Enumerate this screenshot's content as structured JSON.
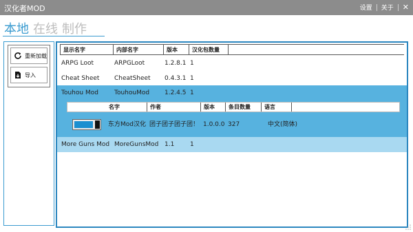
{
  "window": {
    "title": "汉化者MOD",
    "settings": "设置",
    "about": "关于",
    "close": "✕"
  },
  "tabs": [
    "本地",
    "在线",
    "制作"
  ],
  "sidebar": {
    "reload_label": "重新加载",
    "import_label": "导入"
  },
  "grid": {
    "headers": [
      "显示名字",
      "内部名字",
      "版本",
      "汉化包数量"
    ],
    "rows": [
      {
        "display": "ARPG Loot",
        "internal": "ARPGLoot",
        "version": "1.2.8.1",
        "count": "1"
      },
      {
        "display": "Cheat Sheet",
        "internal": "CheatSheet",
        "version": "0.4.3.1",
        "count": "1"
      },
      {
        "display": "Touhou Mod",
        "internal": "TouhouMod",
        "version": "1.2.4.5",
        "count": "1"
      },
      {
        "display": "More Guns Mod",
        "internal": "MoreGunsMod",
        "version": "1.1",
        "count": "1"
      }
    ]
  },
  "subgrid": {
    "headers": [
      "名字",
      "作者",
      "版本",
      "条目数量",
      "语言"
    ],
    "rows": [
      {
        "name": "东方Mod汉化",
        "author": "团子团子团子团！",
        "version": "1.0.0.0",
        "entries": "327",
        "language": "中文(简体)",
        "enabled_level": 0.75
      }
    ]
  },
  "colors": {
    "accent": "#3a9bd0",
    "expanded_row": "#57b2df",
    "selected_row": "#a9d9f1",
    "titlebar": "#8c8c8c"
  }
}
